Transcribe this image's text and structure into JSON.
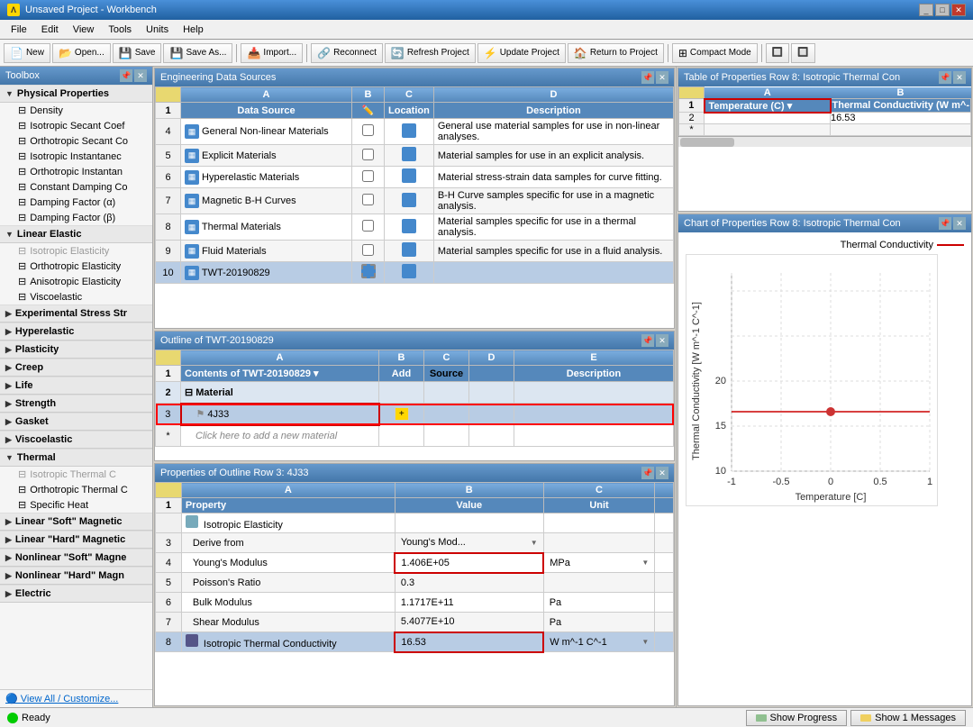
{
  "window": {
    "title": "Unsaved Project - Workbench",
    "icon": "Λ"
  },
  "menu": {
    "items": [
      "File",
      "Edit",
      "View",
      "Tools",
      "Units",
      "Help"
    ]
  },
  "toolbar": {
    "buttons": [
      {
        "label": "New",
        "icon": "📄"
      },
      {
        "label": "Open...",
        "icon": "📂"
      },
      {
        "label": "Save",
        "icon": "💾"
      },
      {
        "label": "Save As...",
        "icon": "💾"
      },
      {
        "label": "Import...",
        "icon": "📥"
      },
      {
        "label": "Reconnect",
        "icon": "🔗"
      },
      {
        "label": "Refresh Project",
        "icon": "🔄"
      },
      {
        "label": "Update Project",
        "icon": "⚡"
      },
      {
        "label": "Return to Project",
        "icon": "🏠"
      },
      {
        "label": "Compact Mode",
        "icon": "⊞"
      }
    ]
  },
  "toolbox": {
    "title": "Toolbox",
    "sections": [
      {
        "name": "Physical Properties",
        "items": [
          "Density",
          "Isotropic Secant Coef",
          "Orthotropic Secant Co",
          "Isotropic Instantanec",
          "Orthotropic Instantan",
          "Constant Damping Co",
          "Damping Factor (α)",
          "Damping Factor (β)"
        ]
      },
      {
        "name": "Linear Elastic",
        "items": [
          "Isotropic Elasticity",
          "Orthotropic Elasticity",
          "Anisotropic Elasticity",
          "Viscoelastic"
        ]
      },
      {
        "name": "Experimental Stress Str",
        "items": []
      },
      {
        "name": "Hyperelastic",
        "items": []
      },
      {
        "name": "Plasticity",
        "items": []
      },
      {
        "name": "Creep",
        "items": []
      },
      {
        "name": "Life",
        "items": []
      },
      {
        "name": "Strength",
        "items": []
      },
      {
        "name": "Gasket",
        "items": []
      },
      {
        "name": "Viscoelastic",
        "items": []
      },
      {
        "name": "Thermal",
        "items": [
          "Isotropic Thermal C",
          "Orthotropic Thermal C",
          "Specific Heat"
        ]
      },
      {
        "name": "Linear \"Soft\" Magnetic",
        "items": []
      },
      {
        "name": "Linear \"Hard\" Magnetic",
        "items": []
      },
      {
        "name": "Nonlinear \"Soft\" Magne",
        "items": []
      },
      {
        "name": "Nonlinear \"Hard\" Magn",
        "items": []
      },
      {
        "name": "Electric",
        "items": []
      }
    ],
    "footer": "View All / Customize..."
  },
  "eng_data_sources": {
    "title": "Engineering Data Sources",
    "columns": [
      "",
      "A",
      "B",
      "C",
      "D"
    ],
    "col_headers": [
      "",
      "Data Source",
      "",
      "Location",
      "Description"
    ],
    "rows": [
      {
        "num": "4",
        "name": "General Non-linear Materials",
        "desc": "General use material samples for use in non-linear analyses."
      },
      {
        "num": "5",
        "name": "Explicit Materials",
        "desc": "Material samples for use in an explicit analysis."
      },
      {
        "num": "6",
        "name": "Hyperelastic Materials",
        "desc": "Material stress-strain data samples for curve fitting."
      },
      {
        "num": "7",
        "name": "Magnetic B-H Curves",
        "desc": "B-H Curve samples specific for use in a magnetic analysis."
      },
      {
        "num": "8",
        "name": "Thermal Materials",
        "desc": "Material samples specific for use in a thermal analysis."
      },
      {
        "num": "9",
        "name": "Fluid Materials",
        "desc": "Material samples specific for use in a fluid analysis."
      },
      {
        "num": "10",
        "name": "TWT-20190829",
        "desc": ""
      }
    ]
  },
  "outline": {
    "title": "Outline of TWT-20190829",
    "columns": [
      "A",
      "B",
      "C",
      "D",
      "E"
    ],
    "col_headers": [
      "Contents of TWT-20190829",
      "Add",
      "Source",
      "Description"
    ],
    "rows": [
      {
        "num": "2",
        "type": "section",
        "name": "Material",
        "indent": false
      },
      {
        "num": "3",
        "type": "material",
        "name": "4J33",
        "indent": true
      },
      {
        "num": "*",
        "type": "new",
        "name": "Click here to add a new material",
        "indent": true
      }
    ]
  },
  "properties": {
    "title": "Properties of Outline Row 3: 4J33",
    "columns": [
      "A",
      "B",
      "C"
    ],
    "col_headers": [
      "Property",
      "Value",
      "Unit"
    ],
    "rows": [
      {
        "num": "",
        "name": "Isotropic Elasticity",
        "value": "",
        "unit": ""
      },
      {
        "num": "3",
        "name": "Derive from",
        "value": "Young's Mod...",
        "unit": "",
        "dropdown": true
      },
      {
        "num": "4",
        "name": "Young's Modulus",
        "value": "1.406E+05",
        "unit": "MPa",
        "highlight_value": true,
        "dropdown": true
      },
      {
        "num": "5",
        "name": "Poisson's Ratio",
        "value": "0.3",
        "unit": ""
      },
      {
        "num": "6",
        "name": "Bulk Modulus",
        "value": "1.1717E+11",
        "unit": "Pa"
      },
      {
        "num": "7",
        "name": "Shear Modulus",
        "value": "5.4077E+10",
        "unit": "Pa"
      },
      {
        "num": "8",
        "name": "Isotropic Thermal Conductivity",
        "value": "16.53",
        "unit": "W m^-1 C^-1",
        "highlight_value": true,
        "highlight_row": true,
        "dropdown": true
      }
    ]
  },
  "table_properties": {
    "title": "Table of Properties Row 8: Isotropic Thermal Con",
    "col_a": "Temperature (C)",
    "col_b": "Thermal Conductivity (W m^-",
    "rows": [
      {
        "num": "1",
        "temp": "",
        "conductivity": ""
      },
      {
        "num": "2",
        "temp": "",
        "conductivity": "16.53"
      }
    ]
  },
  "chart": {
    "title": "Chart of Properties Row 8: Isotropic Thermal Con",
    "series_label": "Thermal Conductivity",
    "x_axis_label": "Temperature [C]",
    "y_axis_label": "Thermal Conductivity [W m^-1 C^-1]",
    "x_ticks": [
      "-1",
      "-0.5",
      "0",
      "0.5",
      "1"
    ],
    "y_ticks": [
      "10",
      "15",
      "20"
    ],
    "data_point": {
      "x": 0,
      "y": 16.53
    }
  },
  "status": {
    "text": "Ready",
    "indicator": "green",
    "buttons": [
      "Show Progress",
      "Show 1 Messages"
    ]
  }
}
